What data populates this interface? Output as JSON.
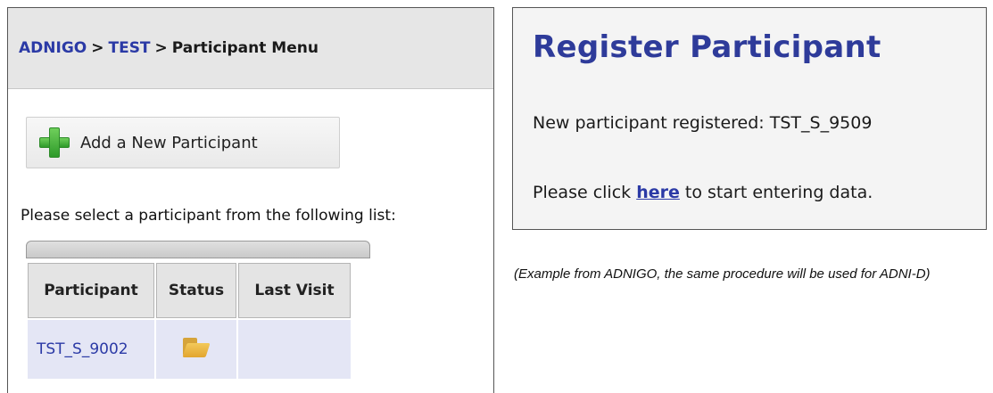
{
  "breadcrumb": {
    "root": "ADNIGO",
    "separator": ">",
    "project": "TEST",
    "current": "Participant Menu"
  },
  "add_participant": {
    "icon": "plus-icon",
    "label": "Add a New Participant"
  },
  "select_prompt": "Please select a participant from the following list:",
  "table": {
    "columns": [
      "Participant",
      "Status",
      "Last Visit"
    ],
    "rows": [
      {
        "participant": "TST_S_9002",
        "status_icon": "folder-icon",
        "last_visit": ""
      }
    ]
  },
  "register": {
    "title": "Register Participant",
    "registered_text": "New participant registered: TST_S_9509",
    "click_prefix": "Please click",
    "click_link": "here",
    "click_suffix": "to start entering data."
  },
  "caption": "(Example from ADNIGO, the same procedure will be used for ADNI-D)",
  "colors": {
    "link": "#2b3aa6",
    "title": "#2e3b9a",
    "row_highlight": "#e4e6f5",
    "plus_green": "#2e9a2a",
    "folder_yellow": "#e2a52f"
  }
}
